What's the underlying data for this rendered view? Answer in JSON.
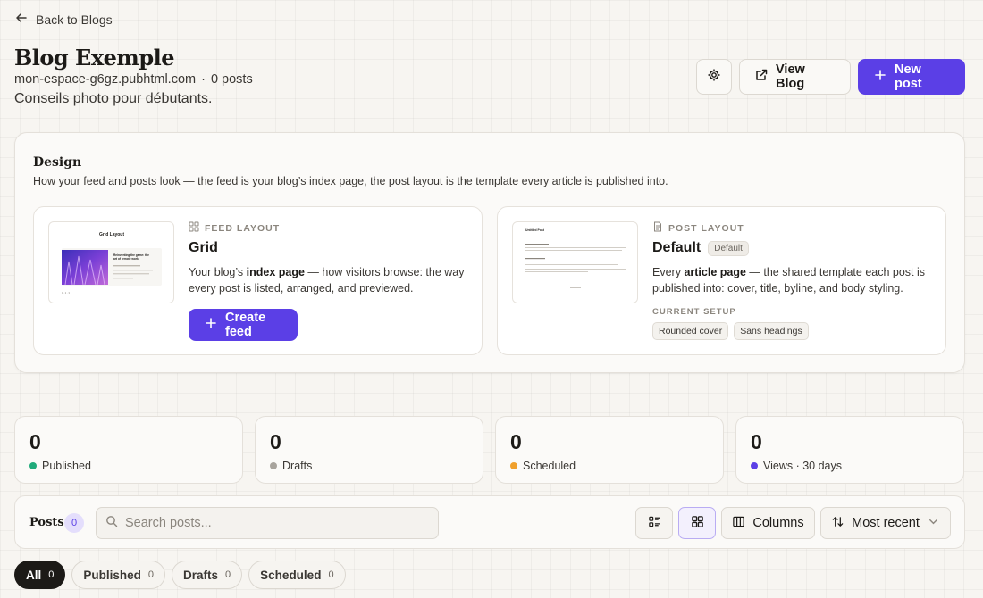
{
  "nav": {
    "back_label": "Back to Blogs"
  },
  "blog": {
    "title": "Blog Exemple",
    "domain": "mon-espace-g6gz.pubhtml.com",
    "separator": "·",
    "post_count": "0 posts",
    "description": "Conseils photo pour débutants."
  },
  "actions": {
    "settings_icon": "gear-icon",
    "view_blog_label": "View Blog",
    "new_post_label": "New post"
  },
  "design": {
    "title": "Design",
    "subtitle": "How your feed and posts look — the feed is your blog’s index page, the post layout is the template every article is published into.",
    "feed": {
      "kicker": "FEED LAYOUT",
      "name": "Grid",
      "desc_pre": "Your blog’s ",
      "desc_bold": "index page",
      "desc_post": " — how visitors browse: the way every post is listed, arranged, and previewed.",
      "button_label": "Create feed",
      "thumb": {
        "title": "Grid Layout",
        "card_heading": "Reinventing the game: the art of remote work",
        "footer": "1 · 2 · 3"
      }
    },
    "post": {
      "kicker": "POST LAYOUT",
      "name": "Default",
      "badge": "Default",
      "desc_pre": "Every ",
      "desc_bold": "article page",
      "desc_post": " — the shared template each post is published into: cover, title, byline, and body styling.",
      "setup_label": "CURRENT SETUP",
      "chips": [
        "Rounded cover",
        "Sans headings"
      ],
      "thumb": {
        "title": "Untitled Post"
      }
    }
  },
  "stats": [
    {
      "value": "0",
      "label": "Published",
      "color": "#1faa7a"
    },
    {
      "value": "0",
      "label": "Drafts",
      "color": "#a8a49d"
    },
    {
      "value": "0",
      "label": "Scheduled",
      "color": "#f0a02c"
    },
    {
      "value": "0",
      "label": "Views · 30 days",
      "color": "#5b3fe6"
    }
  ],
  "posts": {
    "label": "Posts",
    "count": "0",
    "search_placeholder": "Search posts...",
    "columns_label": "Columns",
    "sort_label": "Most recent"
  },
  "filters": [
    {
      "label": "All",
      "count": "0",
      "active": true
    },
    {
      "label": "Published",
      "count": "0"
    },
    {
      "label": "Drafts",
      "count": "0"
    },
    {
      "label": "Scheduled",
      "count": "0"
    }
  ],
  "colors": {
    "accent": "#5b3fe6",
    "background": "#f7f5f1"
  }
}
